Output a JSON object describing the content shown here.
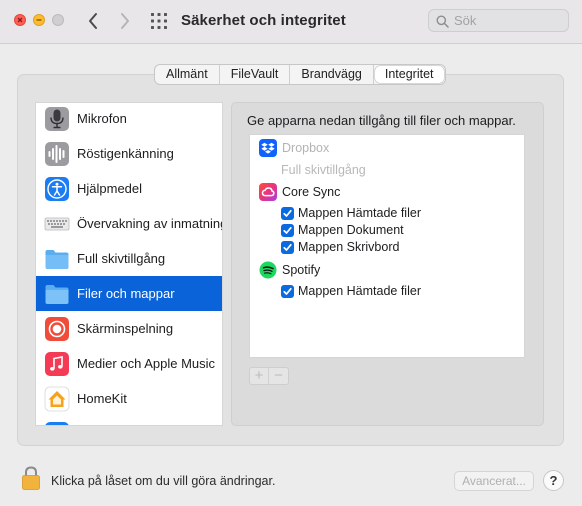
{
  "window": {
    "title": "Säkerhet och integritet",
    "search_placeholder": "Sök"
  },
  "tabs": [
    {
      "label": "Allmänt",
      "active": false
    },
    {
      "label": "FileVault",
      "active": false
    },
    {
      "label": "Brandvägg",
      "active": false
    },
    {
      "label": "Integritet",
      "active": true
    }
  ],
  "sidebar": {
    "selected_index": 5,
    "items": [
      {
        "label": "Mikrofon",
        "icon": "microphone-icon"
      },
      {
        "label": "Röstigenkänning",
        "icon": "speech-recognition-icon"
      },
      {
        "label": "Hjälpmedel",
        "icon": "accessibility-icon"
      },
      {
        "label": "Övervakning av inmatning",
        "icon": "keyboard-icon"
      },
      {
        "label": "Full skivtillgång",
        "icon": "folder-icon"
      },
      {
        "label": "Filer och mappar",
        "icon": "folder-icon"
      },
      {
        "label": "Skärminspelning",
        "icon": "screen-recording-icon"
      },
      {
        "label": "Medier och Apple Music",
        "icon": "music-icon"
      },
      {
        "label": "HomeKit",
        "icon": "home-icon"
      }
    ]
  },
  "content": {
    "heading": "Ge apparna nedan tillgång till filer och mappar.",
    "apps": [
      {
        "name": "Dropbox",
        "icon": "dropbox-icon",
        "enabled": false,
        "note": "Full skivtillgång",
        "permissions": []
      },
      {
        "name": "Core Sync",
        "icon": "creative-cloud-icon",
        "enabled": true,
        "permissions": [
          {
            "label": "Mappen Hämtade filer",
            "checked": true
          },
          {
            "label": "Mappen Dokument",
            "checked": true
          },
          {
            "label": "Mappen Skrivbord",
            "checked": true
          }
        ]
      },
      {
        "name": "Spotify",
        "icon": "spotify-icon",
        "enabled": true,
        "permissions": [
          {
            "label": "Mappen Hämtade filer",
            "checked": true
          }
        ]
      }
    ],
    "add_label": "+",
    "remove_label": "−"
  },
  "footer": {
    "lock_text": "Klicka på låset om du vill göra ändringar.",
    "advanced_label": "Avancerat...",
    "help_label": "?"
  },
  "colors": {
    "accent": "#0a63d8",
    "checkbox": "#0a6ae0",
    "close": "#fe5f57",
    "minimize": "#febc2e"
  }
}
